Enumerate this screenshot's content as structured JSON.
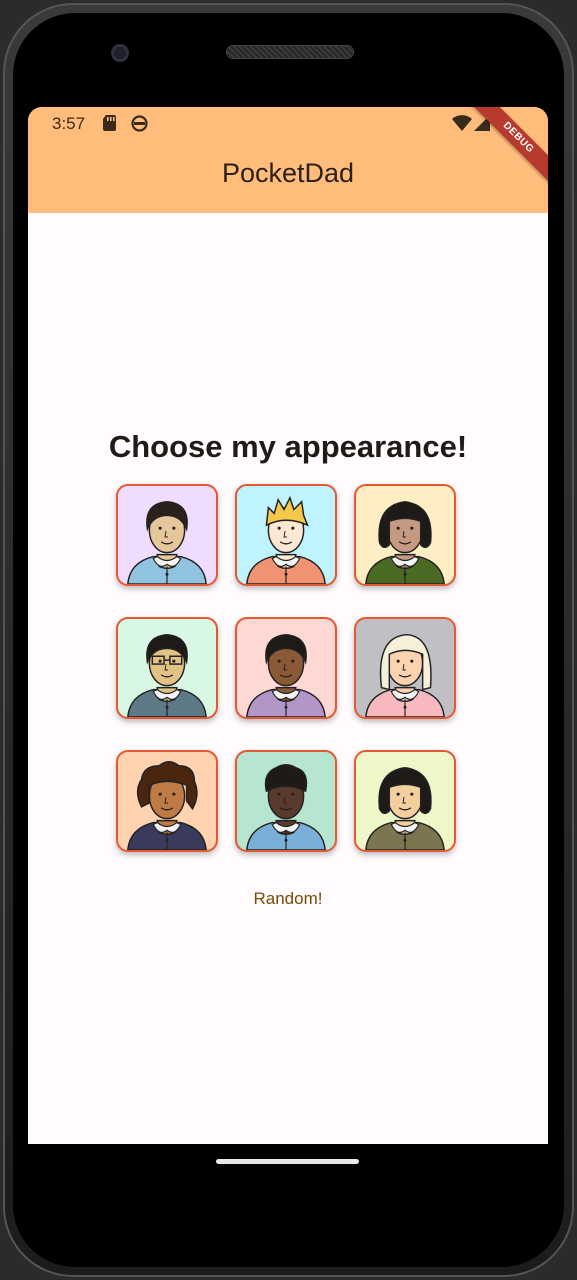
{
  "status_bar": {
    "time": "3:57",
    "icons": [
      "sd-card-icon",
      "face-icon",
      "wifi-icon",
      "signal-icon"
    ]
  },
  "app_bar": {
    "title": "PocketDad",
    "color": "#ffbc7a",
    "debug_banner": "DEBUG"
  },
  "main": {
    "heading": "Choose my appearance!",
    "random_label": "Random!",
    "avatars": [
      {
        "id": "avatar-1",
        "bg": "#f0dcff",
        "skin": "#e6c79b",
        "hair": "#2a211b",
        "shirt": "#8fc3df",
        "hair_style": "short"
      },
      {
        "id": "avatar-2",
        "bg": "#bff3ff",
        "skin": "#fde8d4",
        "hair": "#f4c84a",
        "shirt": "#ef9373",
        "hair_style": "spiky"
      },
      {
        "id": "avatar-3",
        "bg": "#ffeec4",
        "skin": "#c69a82",
        "hair": "#1e1a17",
        "shirt": "#4a6a24",
        "hair_style": "bob"
      },
      {
        "id": "avatar-4",
        "bg": "#d8f8e4",
        "skin": "#e3c286",
        "hair": "#1e1a17",
        "shirt": "#5f7a87",
        "hair_style": "short-glasses"
      },
      {
        "id": "avatar-5",
        "bg": "#ffd8d4",
        "skin": "#8a5a36",
        "hair": "#1e1a17",
        "shirt": "#b396c8",
        "hair_style": "short"
      },
      {
        "id": "avatar-6",
        "bg": "#c0c0c4",
        "skin": "#fcd3b0",
        "hair": "#f6f0da",
        "shirt": "#f7b9bf",
        "hair_style": "long"
      },
      {
        "id": "avatar-7",
        "bg": "#ffd3b0",
        "skin": "#c07a45",
        "hair": "#4a2510",
        "shirt": "#3a3a5c",
        "hair_style": "curly"
      },
      {
        "id": "avatar-8",
        "bg": "#b6e6d0",
        "skin": "#5a3a2c",
        "hair": "#1e1a17",
        "shirt": "#7ab0d8",
        "hair_style": "curly-short"
      },
      {
        "id": "avatar-9",
        "bg": "#eef7c8",
        "skin": "#f4cf9e",
        "hair": "#1e1a17",
        "shirt": "#7b7650",
        "hair_style": "bob"
      }
    ]
  }
}
